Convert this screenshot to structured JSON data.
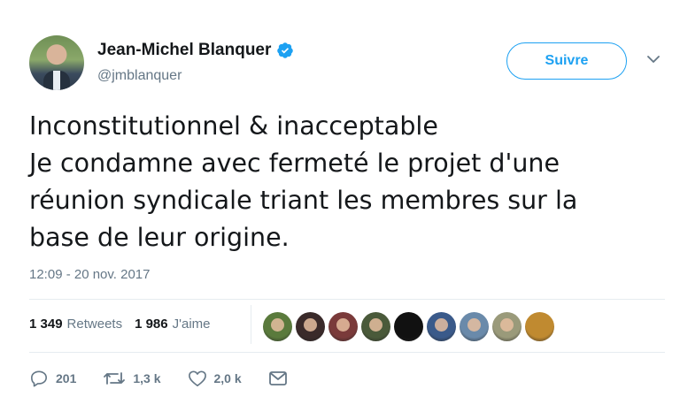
{
  "author": {
    "display_name": "Jean-Michel Blanquer",
    "handle": "@jmblanquer",
    "verified": true
  },
  "follow_button": {
    "label": "Suivre"
  },
  "tweet": {
    "lines": [
      "Inconstitutionnel & inacceptable",
      "Je condamne avec fermeté le projet d'une",
      "réunion syndicale triant les membres sur la",
      "base de leur origine."
    ],
    "timestamp": "12:09 - 20 nov. 2017"
  },
  "stats": {
    "retweets_count": "1 349",
    "retweets_label": "Retweets",
    "likes_count": "1 986",
    "likes_label": "J'aime"
  },
  "likers": [
    {
      "icon": "liker-avatar",
      "color": "#5a7a3c"
    },
    {
      "icon": "liker-avatar",
      "color": "#3a2a2a"
    },
    {
      "icon": "liker-avatar",
      "color": "#7a3a3a"
    },
    {
      "icon": "liker-avatar",
      "color": "#4a5a3a"
    },
    {
      "icon": "liker-avatar",
      "color": "#111111"
    },
    {
      "icon": "liker-avatar",
      "color": "#3a5a8a"
    },
    {
      "icon": "liker-avatar",
      "color": "#6a8aaa"
    },
    {
      "icon": "liker-avatar",
      "color": "#9a9a7a"
    },
    {
      "icon": "liker-avatar",
      "color": "#c08a30"
    }
  ],
  "actions": {
    "reply_count": "201",
    "retweet_count": "1,3 k",
    "like_count": "2,0 k"
  },
  "colors": {
    "accent": "#1da1f2",
    "secondary_text": "#657786",
    "divider": "#e6ecf0"
  }
}
